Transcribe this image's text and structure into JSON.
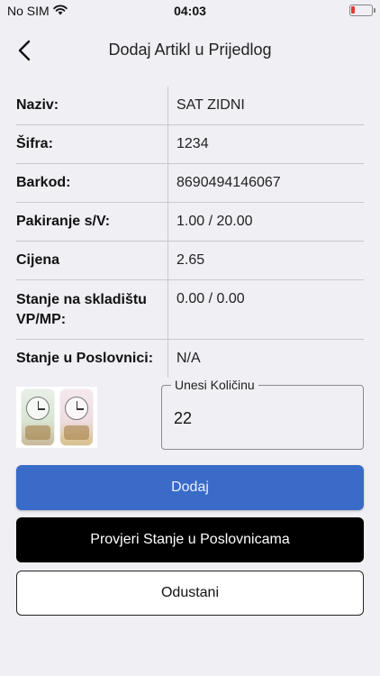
{
  "status_bar": {
    "carrier": "No SIM",
    "time": "04:03",
    "battery_color": "#e53935"
  },
  "nav": {
    "title": "Dodaj Artikl u Prijedlog",
    "back_icon": "chevron-left-icon"
  },
  "details": [
    {
      "label": "Naziv:",
      "value": "SAT ZIDNI"
    },
    {
      "label": "Šifra:",
      "value": "1234"
    },
    {
      "label": "Barkod:",
      "value": "8690494146067"
    },
    {
      "label": "Pakiranje s/V:",
      "value": "1.00 / 20.00"
    },
    {
      "label": "Cijena",
      "value": "2.65"
    },
    {
      "label": "Stanje na skladištu VP/MP:",
      "value": "0.00 / 0.00"
    },
    {
      "label": "Stanje u Poslovnici:",
      "value": "N/A"
    }
  ],
  "quantity": {
    "label": "Unesi Količinu",
    "value": "22"
  },
  "buttons": {
    "add": "Dodaj",
    "check_stock": "Provjeri Stanje u Poslovnicama",
    "cancel": "Odustani"
  },
  "colors": {
    "add_button": "#3a6bc8",
    "check_button": "#000000",
    "background": "#efeff4"
  }
}
